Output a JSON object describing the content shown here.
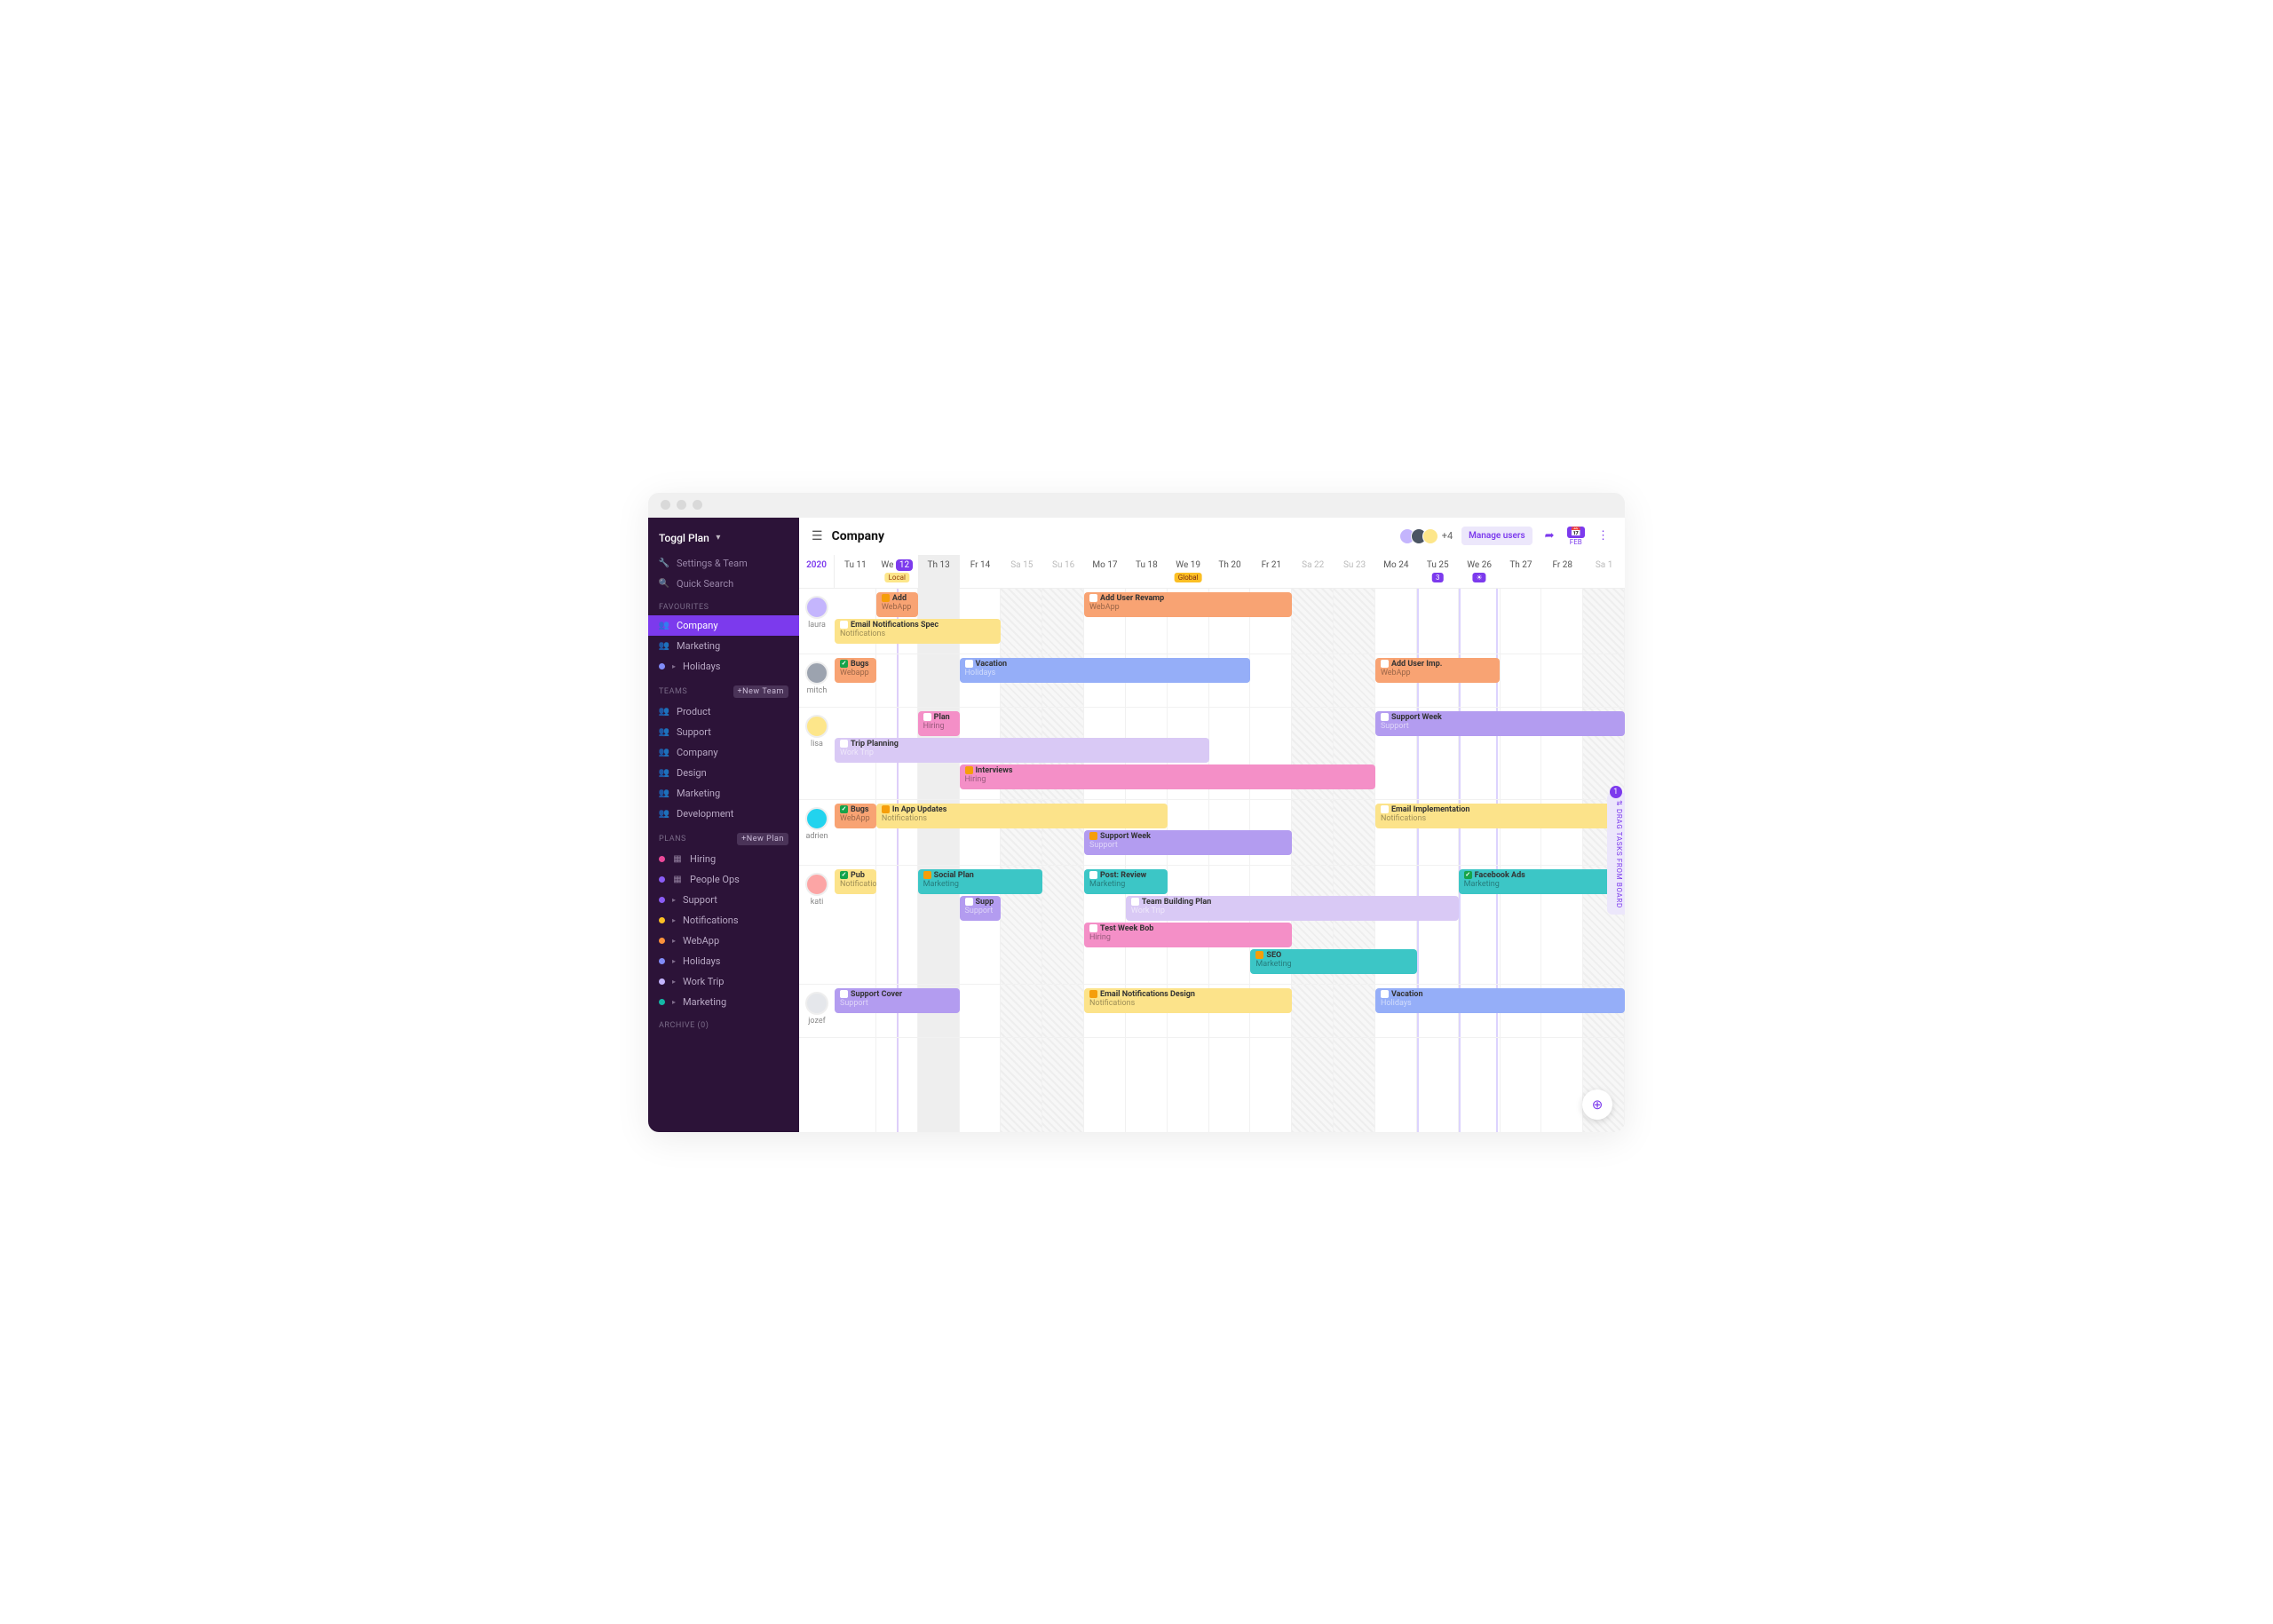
{
  "brand": "Toggl Plan",
  "settings_link": "Settings & Team",
  "search_link": "Quick Search",
  "sections": {
    "favourites": {
      "label": "FAVOURITES",
      "items": [
        {
          "label": "Company",
          "active": true,
          "icon": "people"
        },
        {
          "label": "Marketing",
          "icon": "people"
        },
        {
          "label": "Holidays",
          "icon": "dot",
          "color": "#818cf8",
          "chev": true
        }
      ]
    },
    "teams": {
      "label": "TEAMS",
      "button": "+New Team",
      "items": [
        {
          "label": "Product",
          "icon": "people"
        },
        {
          "label": "Support",
          "icon": "people"
        },
        {
          "label": "Company",
          "icon": "people"
        },
        {
          "label": "Design",
          "icon": "people"
        },
        {
          "label": "Marketing",
          "icon": "people"
        },
        {
          "label": "Development",
          "icon": "people"
        }
      ]
    },
    "plans": {
      "label": "PLANS",
      "button": "+New Plan",
      "items": [
        {
          "label": "Hiring",
          "icon": "dot",
          "color": "#ec4899",
          "board": true
        },
        {
          "label": "People Ops",
          "icon": "dot",
          "color": "#8b5cf6",
          "board": true
        },
        {
          "label": "Support",
          "icon": "dot",
          "color": "#8b5cf6",
          "chev": true
        },
        {
          "label": "Notifications",
          "icon": "dot",
          "color": "#fbbf24",
          "chev": true
        },
        {
          "label": "WebApp",
          "icon": "dot",
          "color": "#fb923c",
          "chev": true
        },
        {
          "label": "Holidays",
          "icon": "dot",
          "color": "#818cf8",
          "chev": true
        },
        {
          "label": "Work Trip",
          "icon": "dot",
          "color": "#c4b5fd",
          "chev": true
        },
        {
          "label": "Marketing",
          "icon": "dot",
          "color": "#14b8a6",
          "chev": true
        }
      ]
    },
    "archive": {
      "label": "ARCHIVE (0)"
    }
  },
  "header": {
    "title": "Company",
    "plus_n": "+4",
    "manage": "Manage users",
    "calendar_month": "FEB"
  },
  "cal": {
    "year": "2020",
    "days": [
      {
        "d": "Tu",
        "n": "11"
      },
      {
        "d": "We",
        "n": "12",
        "today": true,
        "tag": {
          "text": "Local",
          "kind": "local"
        }
      },
      {
        "d": "Th",
        "n": "13",
        "shade": true
      },
      {
        "d": "Fr",
        "n": "14"
      },
      {
        "d": "Sa",
        "n": "15",
        "weekend": true
      },
      {
        "d": "Su",
        "n": "16",
        "weekend": true
      },
      {
        "d": "Mo",
        "n": "17"
      },
      {
        "d": "Tu",
        "n": "18"
      },
      {
        "d": "We",
        "n": "19",
        "tag": {
          "text": "Global",
          "kind": "global"
        }
      },
      {
        "d": "Th",
        "n": "20"
      },
      {
        "d": "Fr",
        "n": "21"
      },
      {
        "d": "Sa",
        "n": "22",
        "weekend": true
      },
      {
        "d": "Su",
        "n": "23",
        "weekend": true
      },
      {
        "d": "Mo",
        "n": "24"
      },
      {
        "d": "Tu",
        "n": "25",
        "tag": {
          "text": "3",
          "kind": "blue"
        }
      },
      {
        "d": "We",
        "n": "26",
        "tag": {
          "text": "☀",
          "kind": "blue"
        }
      },
      {
        "d": "Th",
        "n": "27"
      },
      {
        "d": "Fr",
        "n": "28"
      },
      {
        "d": "Sa",
        "n": "1",
        "weekend": true
      }
    ]
  },
  "colors": {
    "orange": "#f8a373",
    "yellow": "#fce38a",
    "green": "#4ade80",
    "blue": "#95aef8",
    "pink": "#f48fc7",
    "purple": "#b39cf0",
    "teal": "#3cc6c6"
  },
  "users": [
    {
      "name": "laura",
      "color": "#c4b5fd",
      "lanes": 2,
      "tasks": [
        {
          "lane": 0,
          "start": 1,
          "span": 1,
          "title": "Add",
          "sub": "WebApp",
          "bg": "orange",
          "chk": "#f59e0b"
        },
        {
          "lane": 0,
          "start": 6,
          "span": 5,
          "title": "Add User Revamp",
          "sub": "WebApp",
          "bg": "orange",
          "chk": "#fff"
        },
        {
          "lane": 1,
          "start": 0,
          "span": 4,
          "title": "Email Notifications Spec",
          "sub": "Notifications",
          "bg": "yellow",
          "chk": "#fff"
        }
      ]
    },
    {
      "name": "mitch",
      "color": "#9ca3af",
      "lanes": 1,
      "tasks": [
        {
          "lane": 0,
          "start": 0,
          "span": 1,
          "title": "Bugs",
          "sub": "Webapp",
          "bg": "orange",
          "chk": "#16a34a",
          "done": true
        },
        {
          "lane": 0,
          "start": 3,
          "span": 7,
          "title": "Vacation",
          "sub": "Holidays",
          "bg": "blue",
          "chk": "#fff",
          "lightsub": true
        },
        {
          "lane": 0,
          "start": 13,
          "span": 3,
          "title": "Add User Imp.",
          "sub": "WebApp",
          "bg": "orange",
          "chk": "#fff"
        }
      ]
    },
    {
      "name": "lisa",
      "color": "#fde68a",
      "lanes": 3,
      "tasks": [
        {
          "lane": 0,
          "start": 2,
          "span": 1,
          "title": "Plan",
          "sub": "Hiring",
          "bg": "pink",
          "chk": "#fff"
        },
        {
          "lane": 0,
          "start": 13,
          "span": 6,
          "title": "Support Week",
          "sub": "Support",
          "bg": "purple",
          "chk": "#fff",
          "lightsub": true
        },
        {
          "lane": 1,
          "start": 0,
          "span": 9,
          "title": "Trip Planning",
          "sub": "Work Trip",
          "bg": "purple",
          "chk": "#fff",
          "light": true
        },
        {
          "lane": 2,
          "start": 3,
          "span": 10,
          "title": "Interviews",
          "sub": "Hiring",
          "bg": "pink",
          "chk": "#f59e0b"
        }
      ]
    },
    {
      "name": "adrien",
      "color": "#22d3ee",
      "lanes": 2,
      "tasks": [
        {
          "lane": 0,
          "start": 0,
          "span": 1,
          "title": "Bugs",
          "sub": "WebApp",
          "bg": "orange",
          "chk": "#16a34a",
          "done": true,
          "narrow": true
        },
        {
          "lane": 0,
          "start": 1,
          "span": 7,
          "title": "In App Updates",
          "sub": "Notifications",
          "bg": "yellow",
          "chk": "#f59e0b"
        },
        {
          "lane": 0,
          "start": 13,
          "span": 6,
          "title": "Email Implementation",
          "sub": "Notifications",
          "bg": "yellow",
          "chk": "#fff"
        },
        {
          "lane": 1,
          "start": 6,
          "span": 5,
          "title": "Support Week",
          "sub": "Support",
          "bg": "purple",
          "chk": "#f59e0b",
          "lightsub": true
        }
      ]
    },
    {
      "name": "kati",
      "color": "#fca5a5",
      "lanes": 4,
      "tasks": [
        {
          "lane": 0,
          "start": 0,
          "span": 1,
          "title": "Pub",
          "sub": "Notifications",
          "bg": "yellow",
          "chk": "#16a34a",
          "done": true,
          "narrow": true
        },
        {
          "lane": 0,
          "start": 2,
          "span": 3,
          "title": "Social Plan",
          "sub": "Marketing",
          "bg": "teal",
          "chk": "#f59e0b"
        },
        {
          "lane": 0,
          "start": 6,
          "span": 2,
          "title": "Post: Review",
          "sub": "Marketing",
          "bg": "teal",
          "chk": "#fff"
        },
        {
          "lane": 0,
          "start": 15,
          "span": 4,
          "title": "Facebook Ads",
          "sub": "Marketing",
          "bg": "teal",
          "chk": "#16a34a",
          "done": true
        },
        {
          "lane": 1,
          "start": 3,
          "span": 1,
          "title": "Supp",
          "sub": "Support",
          "bg": "purple",
          "chk": "#fff",
          "lightsub": true,
          "narrow": true
        },
        {
          "lane": 1,
          "start": 7,
          "span": 8,
          "title": "Team Building Plan",
          "sub": "Work Trip",
          "bg": "purple",
          "chk": "#fff",
          "light": true
        },
        {
          "lane": 2,
          "start": 6,
          "span": 5,
          "title": "Test Week Bob",
          "sub": "Hiring",
          "bg": "pink",
          "chk": "#fff"
        },
        {
          "lane": 3,
          "start": 10,
          "span": 4,
          "title": "SEO",
          "sub": "Marketing",
          "bg": "teal",
          "chk": "#f59e0b"
        }
      ]
    },
    {
      "name": "jozef",
      "color": "#e5e7eb",
      "lanes": 1,
      "tasks": [
        {
          "lane": 0,
          "start": 0,
          "span": 3,
          "title": "Support Cover",
          "sub": "Support",
          "bg": "purple",
          "chk": "#fff",
          "lightsub": true
        },
        {
          "lane": 0,
          "start": 6,
          "span": 5,
          "title": "Email Notifications Design",
          "sub": "Notifications",
          "bg": "yellow",
          "chk": "#f59e0b"
        },
        {
          "lane": 0,
          "start": 13,
          "span": 6,
          "title": "Vacation",
          "sub": "Holidays",
          "bg": "blue",
          "chk": "#fff",
          "lightsub": true
        }
      ]
    }
  ],
  "dragpanel": {
    "label": "DRAG TASKS FROM BOARD",
    "count": "1"
  }
}
